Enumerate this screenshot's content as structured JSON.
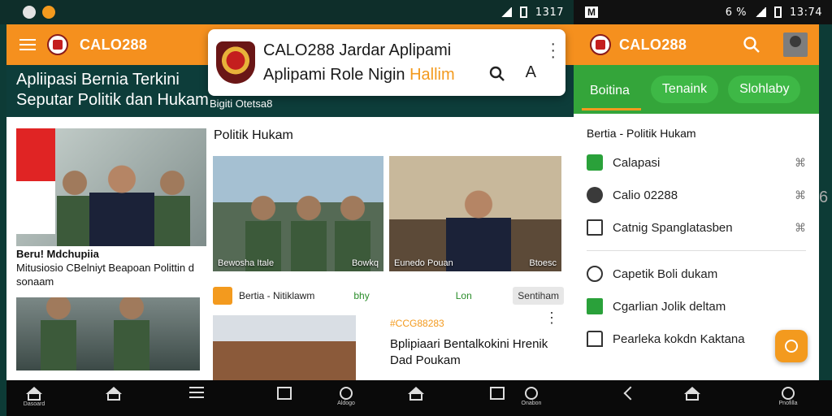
{
  "statusbar": {
    "left_time": "1317",
    "left_icons": [
      "cat-icon",
      "notification-icon",
      "bluetooth-icon",
      "wifi-icon",
      "signal-icon",
      "battery-icon"
    ],
    "right_time": "13:74",
    "right_badge": "M",
    "right_signal_text": "6 %"
  },
  "left": {
    "brand": "CALO288",
    "hero_line1": "Apliipasi Bernia Terkini",
    "hero_line2": "Seputar Politik dan Hukam",
    "hero_sub": "Bigiti Otetsa8",
    "popup": {
      "line1_prefix": "CALO288",
      "line1_rest": " Jardar Aplipami",
      "line2_main": "Aplipami Role Nigin",
      "line2_highlight": "Hallim"
    },
    "big_article": {
      "title": "Beru! Mdchupiia",
      "desc": "Mitusiosio CBelniyt Beapoan Polittin d sonaam"
    },
    "section_title": "Politik Hukam",
    "image1_caption": "Bewosha Itale",
    "image1_right": "Bowkq",
    "image2_caption": "Eunedo Pouan",
    "image2_right": "Btoesc",
    "row": {
      "title": "Bertia - Nitiklawm",
      "new": "bhy",
      "lon": "Lon",
      "chip": "Sentiham"
    },
    "card": {
      "code": "#CCG88283",
      "title": "Bplipiaari Bentalkokini Hrenik Dad Poukam"
    }
  },
  "right": {
    "brand": "CALO288",
    "tabs": [
      "Boitina",
      "Tenaink",
      "Slohlaby"
    ],
    "section": "Bertia - Politik Hukam",
    "list1": [
      {
        "icon": "check-icon",
        "label": "Calapasi"
      },
      {
        "icon": "dot-icon",
        "label": "Calio 02288"
      },
      {
        "icon": "clipboard-icon",
        "label": "Catnig Spanglatasben"
      }
    ],
    "list2": [
      {
        "icon": "chat-icon",
        "label": "Capetik Boli dukam"
      },
      {
        "icon": "building-icon",
        "label": "Cgarlian Jolik deltam"
      },
      {
        "icon": "house-icon",
        "label": "Pearleka kokdn Kaktana"
      }
    ],
    "edge_char": "6"
  },
  "navbar": {
    "home_label": "Dasoard",
    "profile_label": "Aldogo",
    "circle_label": "Onabon",
    "right_circle_label": "Pnofilla"
  }
}
